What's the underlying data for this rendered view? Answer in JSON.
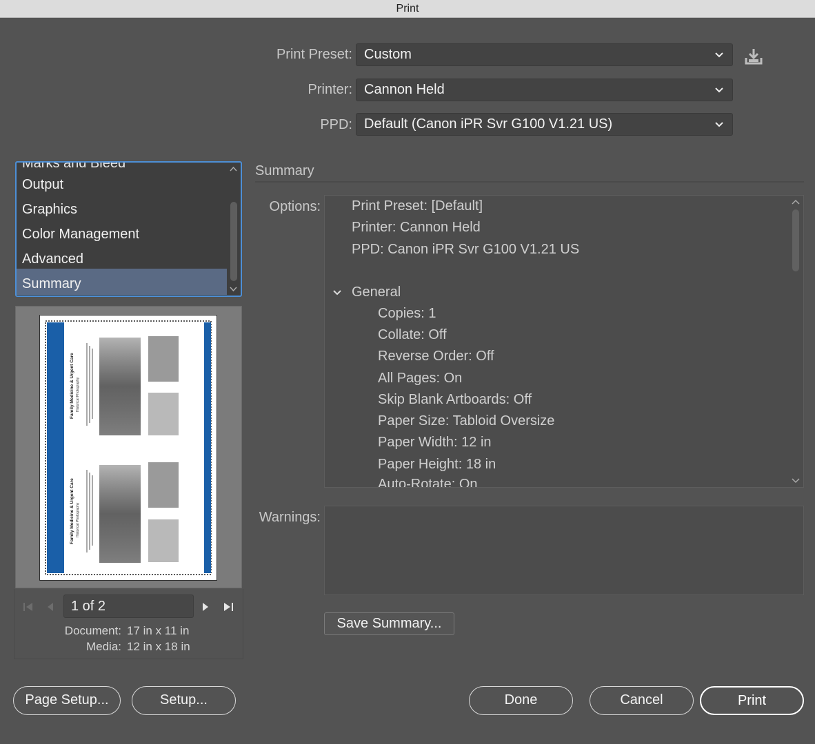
{
  "window": {
    "title": "Print"
  },
  "preset": {
    "label": "Print Preset:",
    "value": "Custom"
  },
  "printer": {
    "label": "Printer:",
    "value": "Cannon Held"
  },
  "ppd": {
    "label": "PPD:",
    "value": "Default (Canon iPR Svr G100 V1.21 US)"
  },
  "categories": {
    "partial_top": "Marks and Bleed",
    "items": [
      "Output",
      "Graphics",
      "Color Management",
      "Advanced",
      "Summary"
    ],
    "selected": "Summary"
  },
  "preview": {
    "page_indicator": "1 of 2",
    "document_label": "Document:",
    "document_value": "17 in x 11 in",
    "media_label": "Media:",
    "media_value": "12 in x 18 in",
    "thumb_heading": "Family Medicine & Urgent Care",
    "thumb_sub": "Historical Photography"
  },
  "summary": {
    "section_title": "Summary",
    "options_label": "Options:",
    "lines": [
      "Print Preset: [Default]",
      "Printer: Cannon Held",
      "PPD: Canon iPR Svr G100 V1.21 US"
    ],
    "group_title": "General",
    "group_lines": [
      "Copies: 1",
      "Collate: Off",
      "Reverse Order: Off",
      "All Pages: On",
      "Skip Blank Artboards: Off",
      "Paper Size: Tabloid Oversize",
      "Paper Width: 12 in",
      "Paper Height: 18 in",
      "Auto-Rotate: On"
    ],
    "warnings_label": "Warnings:",
    "save_button": "Save Summary..."
  },
  "buttons": {
    "page_setup": "Page Setup...",
    "setup": "Setup...",
    "done": "Done",
    "cancel": "Cancel",
    "print": "Print"
  },
  "icons": {
    "save_preset": "download-tray-icon",
    "chevron": "chevron-down-icon"
  },
  "colors": {
    "background": "#535353",
    "selection": "#5a6a84",
    "focus_ring": "#4d8fd6",
    "page_accent": "#1a5fa8"
  }
}
